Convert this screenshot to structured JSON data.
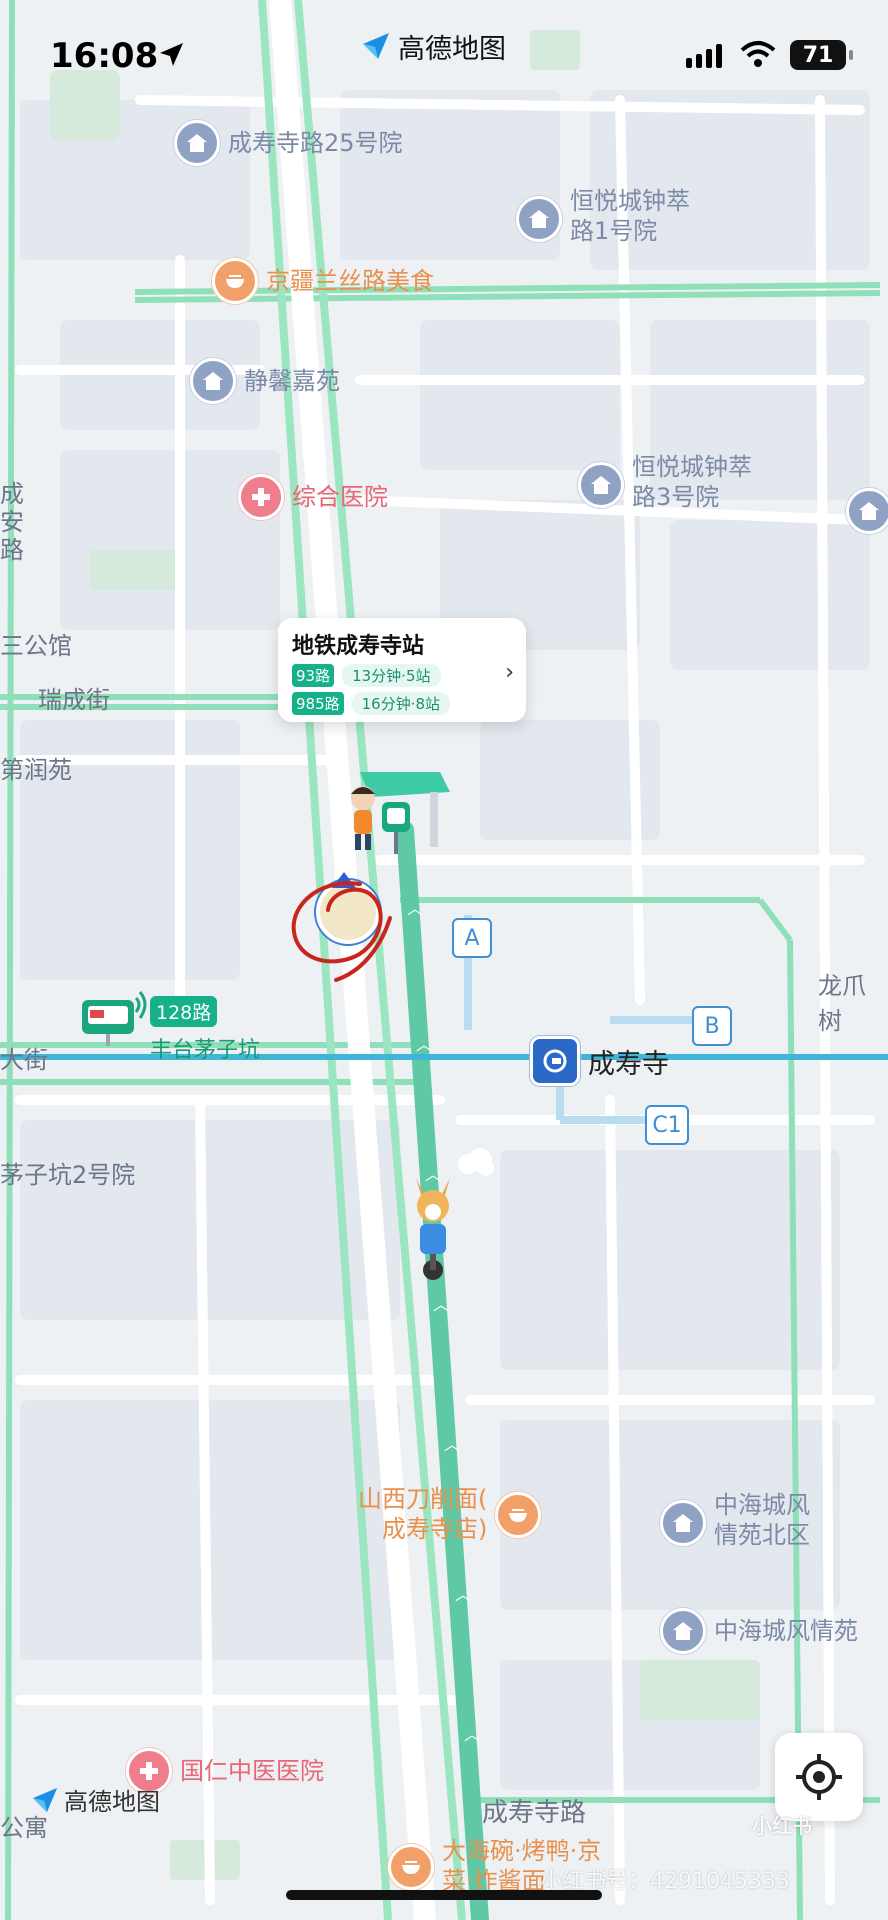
{
  "status_bar": {
    "time": "16:08",
    "battery": "71"
  },
  "app": {
    "brand": "高德地图"
  },
  "poi": {
    "r1": "成寿寺路25号院",
    "r2a": "恒悦城钟萃",
    "r2b": "路1号院",
    "f1": "京疆兰丝路美食",
    "r3": "静馨嘉苑",
    "h1": "综合医院",
    "r4a": "恒悦城钟萃",
    "r4b": "路3号院",
    "f2a": "山西刀削面(",
    "f2b": "成寿寺店)",
    "r5a": "中海城风",
    "r5b": "情苑北区",
    "r6": "中海城风情苑",
    "h2": "国仁中医医院",
    "f3a": "大海碗·烤鸭·京",
    "f3b": "菜·炸酱面"
  },
  "streets": {
    "s1": "瑞成街",
    "s2": "第润苑",
    "s3": "三公馆",
    "s4a": "成",
    "s4b": "安",
    "s4c": "路",
    "s5": "大街",
    "s6": "茅子坑2号院",
    "s7": "龙爪树",
    "s8": "成寿寺路",
    "s9": "公寓",
    "bus_stop": "丰台茅子坑"
  },
  "station_card": {
    "title": "地铁成寿寺站",
    "routes": [
      {
        "line": "93路",
        "info": "13分钟·5站"
      },
      {
        "line": "985路",
        "info": "16分钟·8站"
      }
    ]
  },
  "bus_label": "128路",
  "metro": {
    "name": "成寿寺"
  },
  "exits": [
    "A",
    "B",
    "C1"
  ],
  "watermark": {
    "text": "小红书号：4291045333",
    "xhs": "小红书"
  },
  "colors": {
    "route": "#16b089",
    "metro": "#2a69c8"
  }
}
